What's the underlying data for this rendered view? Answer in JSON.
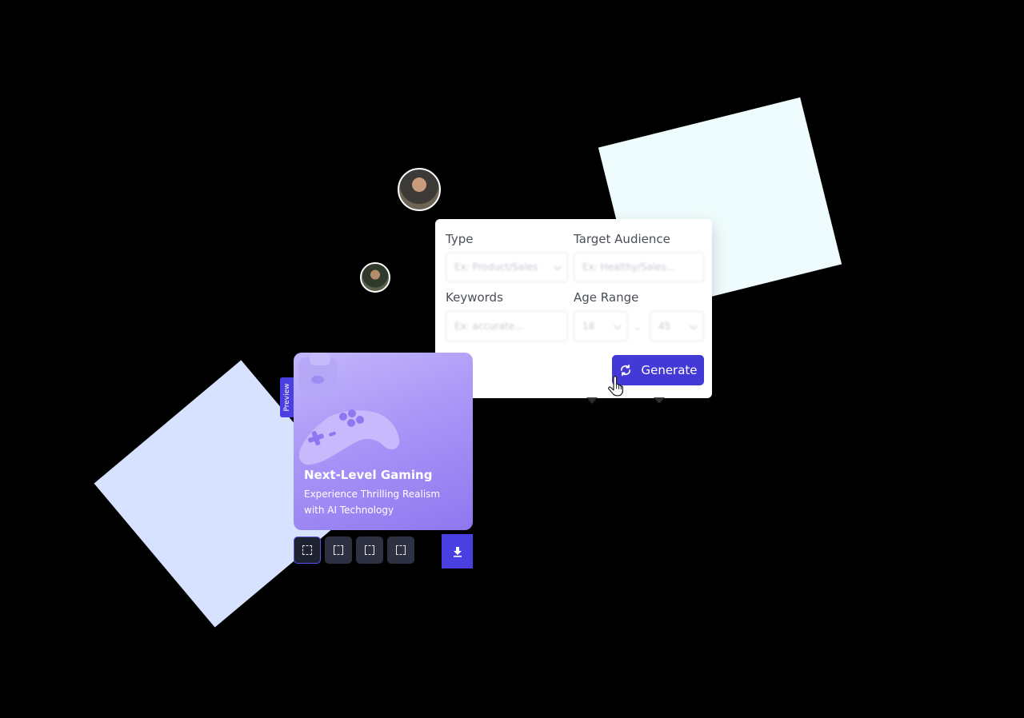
{
  "form": {
    "type_label": "Type",
    "type_placeholder": "Ex: Product/Sales",
    "audience_label": "Target Audience",
    "audience_placeholder": "Ex: Healthy/Sales...",
    "keywords_label": "Keywords",
    "keywords_placeholder": "Ex: accurate...",
    "age_label": "Age Range",
    "age_min": "18",
    "age_max": "45",
    "generate_label": "Generate"
  },
  "preview": {
    "tab_label": "Preview",
    "title": "Next-Level Gaming",
    "subtitle": "Experience Thrilling Realism with AI Technology"
  },
  "toolbar": {
    "ratio_buttons": [
      "ratio-1",
      "ratio-2",
      "ratio-3",
      "ratio-4"
    ],
    "download_icon": "download-icon"
  },
  "colors": {
    "accent": "#4339D6",
    "card_bg": "#FFFFFF",
    "preview_gradient_start": "#C3B6FB",
    "preview_gradient_end": "#8F77F0",
    "deco_cyan": "#EFFCFD",
    "deco_blue": "#D6E2FF"
  }
}
